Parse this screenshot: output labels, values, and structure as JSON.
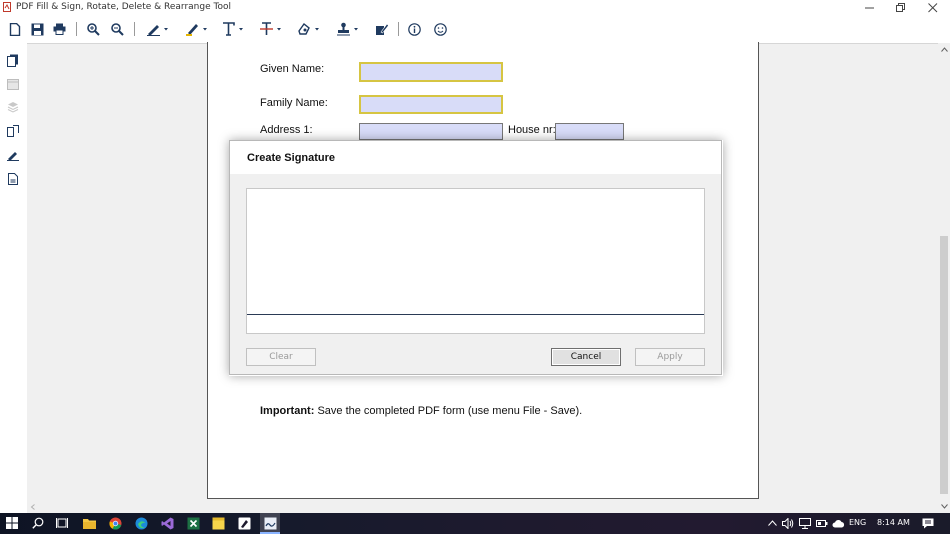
{
  "window": {
    "title": "PDF Fill & Sign, Rotate, Delete & Rearrange Tool"
  },
  "toolbar": {
    "buttons": [
      {
        "icon": "new-document-icon"
      },
      {
        "icon": "save-icon"
      },
      {
        "icon": "print-icon"
      },
      {
        "icon": "zoom-in-icon"
      },
      {
        "icon": "zoom-out-icon"
      },
      {
        "icon": "pen-icon"
      },
      {
        "icon": "highlighter-icon"
      },
      {
        "icon": "text-icon"
      },
      {
        "icon": "strikethrough-icon"
      },
      {
        "icon": "shape-icon"
      },
      {
        "icon": "stamp-icon"
      },
      {
        "icon": "sign-icon"
      },
      {
        "icon": "info-icon"
      },
      {
        "icon": "smiley-icon"
      }
    ]
  },
  "form": {
    "given_name_label": "Given Name:",
    "family_name_label": "Family Name:",
    "address_label": "Address 1:",
    "house_label": "House nr:",
    "important_bold": "Important:",
    "important_text": " Save the completed PDF form (use menu File - Save)."
  },
  "dialog": {
    "title": "Create Signature",
    "clear_label": "Clear",
    "cancel_label": "Cancel",
    "apply_label": "Apply"
  },
  "taskbar": {
    "language": "ENG",
    "time": "8:14 AM"
  },
  "colors": {
    "field_fill": "#d8dcf8",
    "field_highlight_border": "#d6c542",
    "signature_line": "#2a3a55"
  }
}
